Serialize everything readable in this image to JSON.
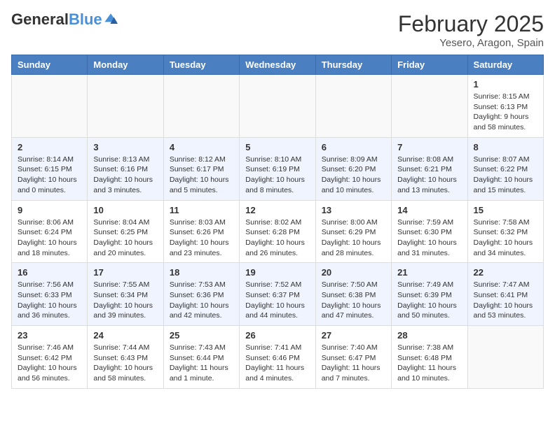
{
  "header": {
    "logo_line1": "General",
    "logo_line2": "Blue",
    "month_title": "February 2025",
    "subtitle": "Yesero, Aragon, Spain"
  },
  "days_of_week": [
    "Sunday",
    "Monday",
    "Tuesday",
    "Wednesday",
    "Thursday",
    "Friday",
    "Saturday"
  ],
  "weeks": [
    [
      {
        "day": "",
        "info": ""
      },
      {
        "day": "",
        "info": ""
      },
      {
        "day": "",
        "info": ""
      },
      {
        "day": "",
        "info": ""
      },
      {
        "day": "",
        "info": ""
      },
      {
        "day": "",
        "info": ""
      },
      {
        "day": "1",
        "info": "Sunrise: 8:15 AM\nSunset: 6:13 PM\nDaylight: 9 hours\nand 58 minutes."
      }
    ],
    [
      {
        "day": "2",
        "info": "Sunrise: 8:14 AM\nSunset: 6:15 PM\nDaylight: 10 hours\nand 0 minutes."
      },
      {
        "day": "3",
        "info": "Sunrise: 8:13 AM\nSunset: 6:16 PM\nDaylight: 10 hours\nand 3 minutes."
      },
      {
        "day": "4",
        "info": "Sunrise: 8:12 AM\nSunset: 6:17 PM\nDaylight: 10 hours\nand 5 minutes."
      },
      {
        "day": "5",
        "info": "Sunrise: 8:10 AM\nSunset: 6:19 PM\nDaylight: 10 hours\nand 8 minutes."
      },
      {
        "day": "6",
        "info": "Sunrise: 8:09 AM\nSunset: 6:20 PM\nDaylight: 10 hours\nand 10 minutes."
      },
      {
        "day": "7",
        "info": "Sunrise: 8:08 AM\nSunset: 6:21 PM\nDaylight: 10 hours\nand 13 minutes."
      },
      {
        "day": "8",
        "info": "Sunrise: 8:07 AM\nSunset: 6:22 PM\nDaylight: 10 hours\nand 15 minutes."
      }
    ],
    [
      {
        "day": "9",
        "info": "Sunrise: 8:06 AM\nSunset: 6:24 PM\nDaylight: 10 hours\nand 18 minutes."
      },
      {
        "day": "10",
        "info": "Sunrise: 8:04 AM\nSunset: 6:25 PM\nDaylight: 10 hours\nand 20 minutes."
      },
      {
        "day": "11",
        "info": "Sunrise: 8:03 AM\nSunset: 6:26 PM\nDaylight: 10 hours\nand 23 minutes."
      },
      {
        "day": "12",
        "info": "Sunrise: 8:02 AM\nSunset: 6:28 PM\nDaylight: 10 hours\nand 26 minutes."
      },
      {
        "day": "13",
        "info": "Sunrise: 8:00 AM\nSunset: 6:29 PM\nDaylight: 10 hours\nand 28 minutes."
      },
      {
        "day": "14",
        "info": "Sunrise: 7:59 AM\nSunset: 6:30 PM\nDaylight: 10 hours\nand 31 minutes."
      },
      {
        "day": "15",
        "info": "Sunrise: 7:58 AM\nSunset: 6:32 PM\nDaylight: 10 hours\nand 34 minutes."
      }
    ],
    [
      {
        "day": "16",
        "info": "Sunrise: 7:56 AM\nSunset: 6:33 PM\nDaylight: 10 hours\nand 36 minutes."
      },
      {
        "day": "17",
        "info": "Sunrise: 7:55 AM\nSunset: 6:34 PM\nDaylight: 10 hours\nand 39 minutes."
      },
      {
        "day": "18",
        "info": "Sunrise: 7:53 AM\nSunset: 6:36 PM\nDaylight: 10 hours\nand 42 minutes."
      },
      {
        "day": "19",
        "info": "Sunrise: 7:52 AM\nSunset: 6:37 PM\nDaylight: 10 hours\nand 44 minutes."
      },
      {
        "day": "20",
        "info": "Sunrise: 7:50 AM\nSunset: 6:38 PM\nDaylight: 10 hours\nand 47 minutes."
      },
      {
        "day": "21",
        "info": "Sunrise: 7:49 AM\nSunset: 6:39 PM\nDaylight: 10 hours\nand 50 minutes."
      },
      {
        "day": "22",
        "info": "Sunrise: 7:47 AM\nSunset: 6:41 PM\nDaylight: 10 hours\nand 53 minutes."
      }
    ],
    [
      {
        "day": "23",
        "info": "Sunrise: 7:46 AM\nSunset: 6:42 PM\nDaylight: 10 hours\nand 56 minutes."
      },
      {
        "day": "24",
        "info": "Sunrise: 7:44 AM\nSunset: 6:43 PM\nDaylight: 10 hours\nand 58 minutes."
      },
      {
        "day": "25",
        "info": "Sunrise: 7:43 AM\nSunset: 6:44 PM\nDaylight: 11 hours\nand 1 minute."
      },
      {
        "day": "26",
        "info": "Sunrise: 7:41 AM\nSunset: 6:46 PM\nDaylight: 11 hours\nand 4 minutes."
      },
      {
        "day": "27",
        "info": "Sunrise: 7:40 AM\nSunset: 6:47 PM\nDaylight: 11 hours\nand 7 minutes."
      },
      {
        "day": "28",
        "info": "Sunrise: 7:38 AM\nSunset: 6:48 PM\nDaylight: 11 hours\nand 10 minutes."
      },
      {
        "day": "",
        "info": ""
      }
    ]
  ]
}
